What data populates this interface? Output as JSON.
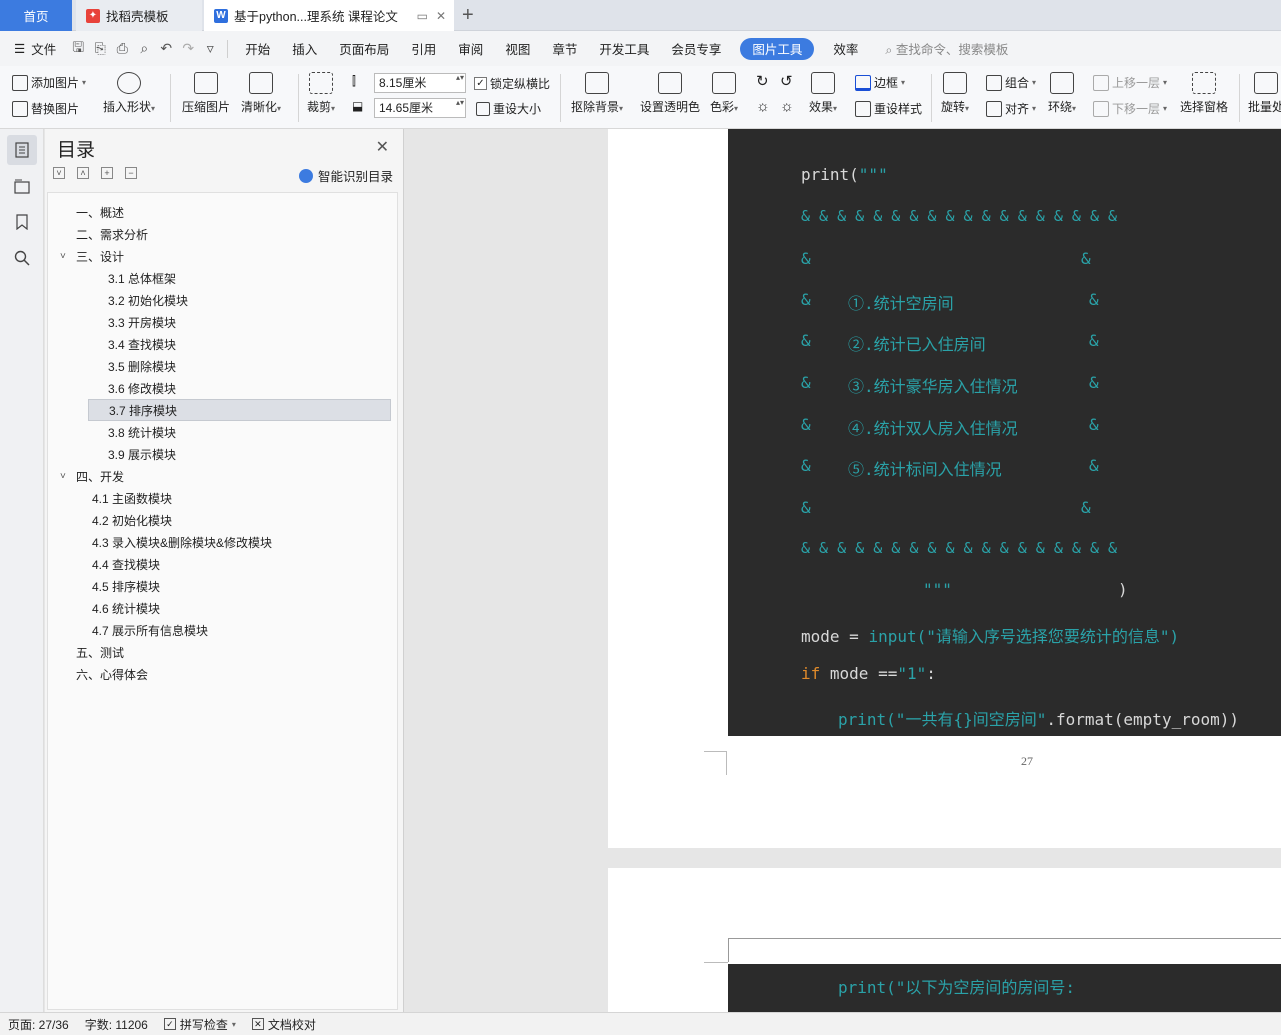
{
  "tabs": [
    {
      "label": "首页"
    },
    {
      "label": "找稻壳模板"
    },
    {
      "label": "基于python...理系统 课程论文"
    }
  ],
  "menu": {
    "file": "文件",
    "items": [
      "开始",
      "插入",
      "页面布局",
      "引用",
      "审阅",
      "视图",
      "章节",
      "开发工具",
      "会员专享"
    ],
    "active": "图片工具",
    "efficiency": "效率",
    "search": "查找命令、搜索模板"
  },
  "ribbon": {
    "add_image": "添加图片",
    "replace_image": "替换图片",
    "insert_shape": "插入形状",
    "compress": "压缩图片",
    "clarify": "清晰化",
    "crop": "裁剪",
    "width": "8.15厘米",
    "height": "14.65厘米",
    "lock_ratio": "锁定纵横比",
    "reset_size": "重设大小",
    "remove_bg": "抠除背景",
    "set_transparent": "设置透明色",
    "color": "色彩",
    "effect": "效果",
    "border": "边框",
    "reset_style": "重设样式",
    "rotate": "旋转",
    "group": "组合",
    "align": "对齐",
    "wrap": "环绕",
    "bring_forward": "上移一层",
    "send_backward": "下移一层",
    "selection_pane": "选择窗格",
    "batch": "批量处"
  },
  "toc": {
    "title": "目录",
    "smart": "智能识别目录",
    "items": [
      {
        "label": "一、概述",
        "level": 1
      },
      {
        "label": "二、需求分析",
        "level": 1
      },
      {
        "label": "三、设计",
        "level": 1,
        "expanded": true
      },
      {
        "label": "3.1 总体框架",
        "level": 2
      },
      {
        "label": "3.2 初始化模块",
        "level": 2
      },
      {
        "label": "3.3 开房模块",
        "level": 2
      },
      {
        "label": "3.4 查找模块",
        "level": 2
      },
      {
        "label": "3.5 删除模块",
        "level": 2
      },
      {
        "label": "3.6 修改模块",
        "level": 2
      },
      {
        "label": "3.7 排序模块",
        "level": 2,
        "selected": true
      },
      {
        "label": "3.8 统计模块",
        "level": 2
      },
      {
        "label": "3.9 展示模块",
        "level": 2
      },
      {
        "label": "四、开发",
        "level": 1,
        "expanded": true
      },
      {
        "label": "4.1 主函数模块",
        "level": 3
      },
      {
        "label": "4.2 初始化模块",
        "level": 3
      },
      {
        "label": "4.3 录入模块&删除模块&修改模块",
        "level": 3
      },
      {
        "label": "4.4 查找模块",
        "level": 3
      },
      {
        "label": "4.5 排序模块",
        "level": 3
      },
      {
        "label": "4.6 统计模块",
        "level": 3
      },
      {
        "label": "4.7 展示所有信息模块",
        "level": 3
      },
      {
        "label": "五、测试",
        "level": 1
      },
      {
        "label": "六、心得体会",
        "level": 1
      }
    ]
  },
  "code": {
    "l1a": "print(",
    "l1b": "\"\"\"",
    "l2": "& & & & & & & & & & & & & & & & & &",
    "l3a": "&",
    "l3b": "&",
    "l4a": "&",
    "l4b": "①.统计空房间",
    "l4c": "&",
    "l5a": "&",
    "l5b": "②.统计已入住房间",
    "l5c": "&",
    "l6a": "&",
    "l6b": "③.统计豪华房入住情况",
    "l6c": "&",
    "l7a": "&",
    "l7b": "④.统计双人房入住情况",
    "l7c": "&",
    "l8a": "&",
    "l8b": "⑤.统计标间入住情况",
    "l8c": "&",
    "l9a": "&",
    "l9b": "&",
    "l10": "& & & & & & & & & & & & & & & & & &",
    "l11a": "\"\"\"",
    "l11b": ")",
    "l12a": "mode = ",
    "l12b": "input",
    "l12c": "(\"请输入序号选择您要统计的信息\")",
    "l13a": "if",
    "l13b": " mode ==",
    "l13c": "\"1\"",
    "l13d": ":",
    "l14a": "print",
    "l14b": "(\"一共有{}间空房间\"",
    "l14c": ".format(empty_room))",
    "p2": "print(\"以下为空房间的房间号:"
  },
  "page_number": "27",
  "status": {
    "page": "页面: 27/36",
    "words": "字数: 11206",
    "spell": "拼写检查",
    "proof": "文档校对"
  }
}
